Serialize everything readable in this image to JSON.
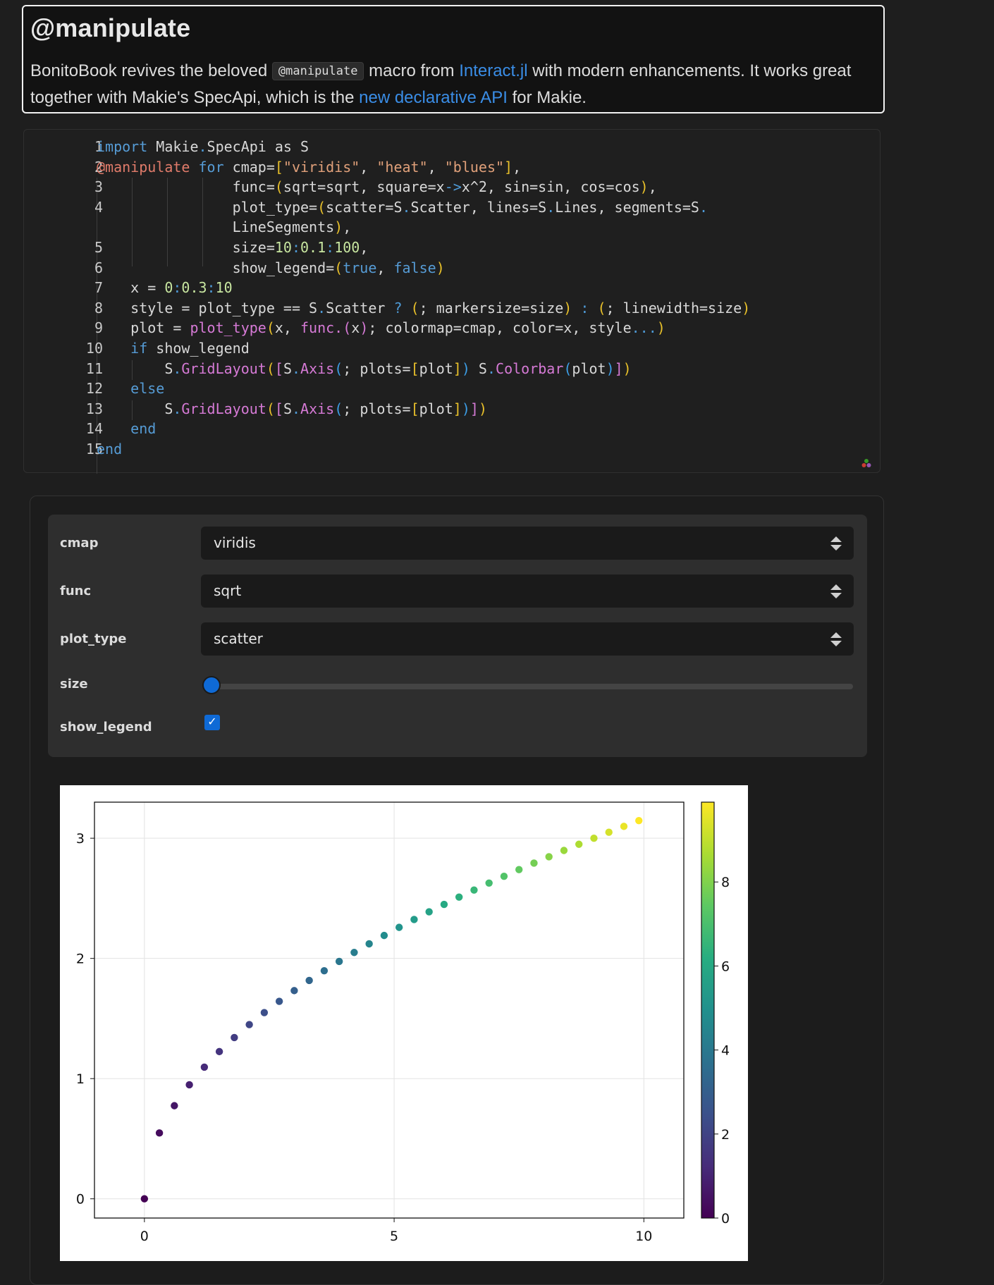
{
  "markdown": {
    "title": "@manipulate",
    "intro_text": "BonitoBook revives the beloved",
    "inline_code": "@manipulate",
    "text_mid": "macro from",
    "link1": "Interact.jl",
    "text_after_link1": "with modern enhancements. It works great together with Makie's SpecApi, which is the",
    "link2": "new declarative API",
    "text_end": "for Makie."
  },
  "code": {
    "lines": [
      {
        "n": "1"
      },
      {
        "n": "2"
      },
      {
        "n": "3"
      },
      {
        "n": "4"
      },
      {
        "n": ""
      },
      {
        "n": "5"
      },
      {
        "n": "6"
      },
      {
        "n": "7"
      },
      {
        "n": "8"
      },
      {
        "n": "9"
      },
      {
        "n": "10"
      },
      {
        "n": "11"
      },
      {
        "n": "12"
      },
      {
        "n": "13"
      },
      {
        "n": "14"
      },
      {
        "n": "15"
      }
    ]
  },
  "controls": {
    "cmap": {
      "label": "cmap",
      "value": "viridis",
      "options": [
        "viridis",
        "heat",
        "blues"
      ]
    },
    "func": {
      "label": "func",
      "value": "sqrt",
      "options": [
        "sqrt",
        "square",
        "sin",
        "cos"
      ]
    },
    "plot_type": {
      "label": "plot_type",
      "value": "scatter",
      "options": [
        "scatter",
        "lines",
        "segments"
      ]
    },
    "size": {
      "label": "size",
      "min": 10,
      "max": 100,
      "step": 0.1,
      "value": 10
    },
    "show_legend": {
      "label": "show_legend",
      "checked": true,
      "check_glyph": "✓"
    }
  },
  "chart_data": {
    "type": "scatter",
    "x_start": 0,
    "x_step": 0.3,
    "x_end": 10,
    "func": "sqrt",
    "colormap": "viridis",
    "xlim": [
      -1,
      10.8
    ],
    "ylim": [
      -0.16,
      3.3
    ],
    "xticks": [
      0,
      5,
      10
    ],
    "yticks": [
      0,
      1,
      2,
      3
    ],
    "grid": true,
    "colorbar": {
      "ticks": [
        0,
        2,
        4,
        6,
        8
      ],
      "range": [
        0,
        9.9
      ]
    }
  }
}
